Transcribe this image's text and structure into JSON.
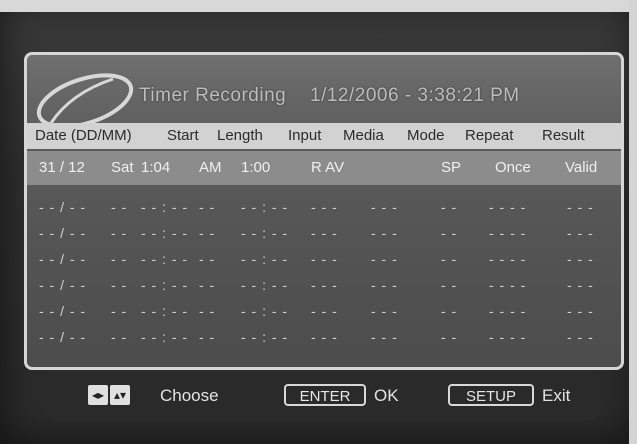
{
  "title": {
    "program": "Timer Recording",
    "datetime": "1/12/2006 - 3:38:21 PM"
  },
  "columns": [
    "Date (DD/MM)",
    "Start",
    "Length",
    "Input",
    "Media",
    "Mode",
    "Repeat",
    "Result"
  ],
  "entry": {
    "date": "31 / 12",
    "day": "Sat",
    "start": "1:04",
    "ampm": "AM",
    "length": "1:00",
    "input": "R AV",
    "mode": "SP",
    "repeat": "Once",
    "result": "Valid"
  },
  "empty_entry": {
    "date": "- - / - -",
    "day": "- -",
    "start": "- - : - -",
    "ampm": "- -",
    "length": "- - : - -",
    "input": "- - -",
    "media": "- - -",
    "mode": "- -",
    "repeat": "- - - -",
    "result": "- - -"
  },
  "empty_row_count": 6,
  "footer": {
    "choose_label": "Choose",
    "enter_key": "ENTER",
    "ok_label": "OK",
    "setup_key": "SETUP",
    "exit_label": "Exit"
  },
  "icons": {
    "left_right": "left-right-arrows-icon",
    "up_down": "up-down-arrows-icon"
  }
}
